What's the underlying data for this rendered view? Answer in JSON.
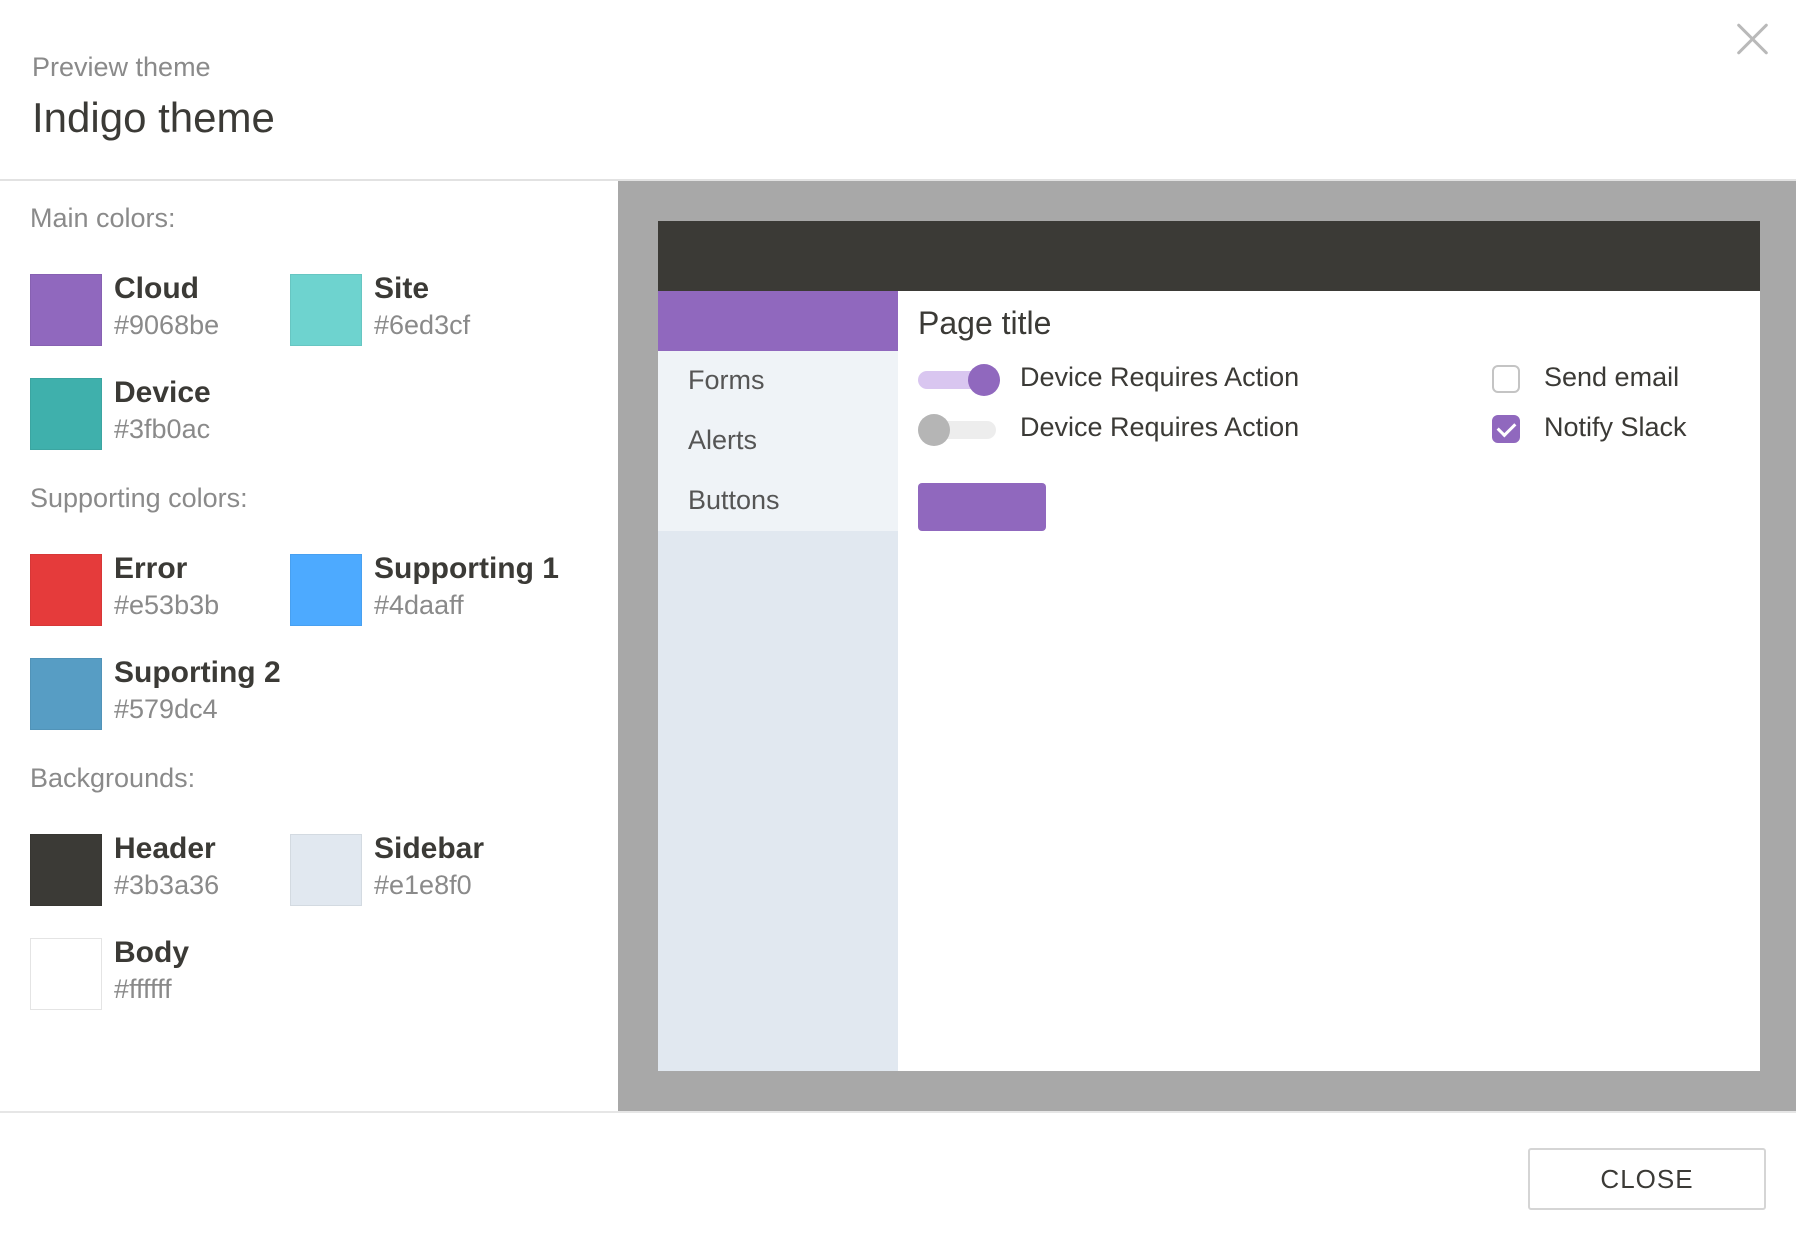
{
  "header": {
    "kicker": "Preview theme",
    "title": "Indigo theme",
    "close_icon": "close-icon"
  },
  "sections": {
    "main": "Main colors:",
    "supporting": "Supporting colors:",
    "backgrounds": "Backgrounds:"
  },
  "main_colors": [
    {
      "name": "Cloud",
      "hex": "#9068be"
    },
    {
      "name": "Site",
      "hex": "#6ed3cf"
    },
    {
      "name": "Device",
      "hex": "#3fb0ac"
    }
  ],
  "supporting_colors": [
    {
      "name": "Error",
      "hex": "#e53b3b"
    },
    {
      "name": "Supporting 1",
      "hex": "#4daaff"
    },
    {
      "name": "Suporting 2",
      "hex": "#579dc4"
    }
  ],
  "backgrounds": [
    {
      "name": "Header",
      "hex": "#3b3a36"
    },
    {
      "name": "Sidebar",
      "hex": "#e1e8f0"
    },
    {
      "name": "Body",
      "hex": "#ffffff"
    }
  ],
  "preview": {
    "page_title": "Page title",
    "nav": [
      "Forms",
      "Alerts",
      "Buttons"
    ],
    "toggles": [
      {
        "label": "Device Requires Action",
        "on": true
      },
      {
        "label": "Device Requires Action",
        "on": false
      }
    ],
    "checkboxes": [
      {
        "label": "Send email",
        "checked": false
      },
      {
        "label": "Notify Slack",
        "checked": true
      }
    ]
  },
  "footer": {
    "close_label": "CLOSE"
  }
}
